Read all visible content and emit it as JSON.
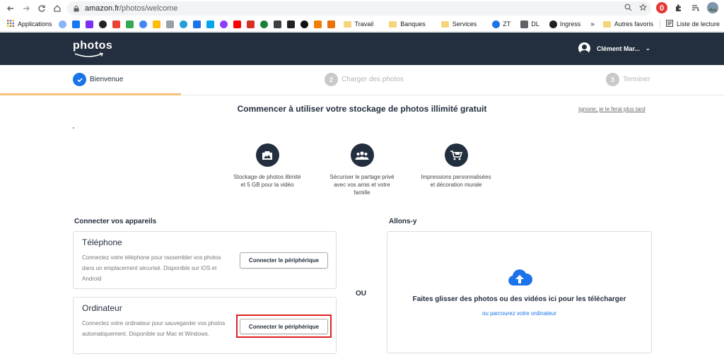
{
  "browser": {
    "url_host": "amazon.fr",
    "url_path": "/photos/welcome",
    "bookmarks": [
      {
        "label": "Applications",
        "icon": "apps-grid-icon",
        "color": "#e37400"
      },
      {
        "label": "",
        "icon": "network-icon",
        "color": "#8ab4f8"
      },
      {
        "label": "",
        "icon": "facebook-icon",
        "color": "#1877f2"
      },
      {
        "label": "",
        "icon": "bookmark-f-icon",
        "color": "#7b2ff7"
      },
      {
        "label": "",
        "icon": "bookmark-circle-icon",
        "color": "#222222"
      },
      {
        "label": "",
        "icon": "gmail-icon",
        "color": "#ea4335"
      },
      {
        "label": "",
        "icon": "drive-icon",
        "color": "#34a853"
      },
      {
        "label": "",
        "icon": "calendar-icon",
        "color": "#4285f4"
      },
      {
        "label": "",
        "icon": "keep-icon",
        "color": "#fbbc04"
      },
      {
        "label": "",
        "icon": "bookmark-s-icon",
        "color": "#9aa0a6"
      },
      {
        "label": "",
        "icon": "telegram-icon",
        "color": "#229ed9"
      },
      {
        "label": "",
        "icon": "chat-icon",
        "color": "#1a73e8"
      },
      {
        "label": "",
        "icon": "bookmark-teal-icon",
        "color": "#00a4ef"
      },
      {
        "label": "",
        "icon": "messenger-icon",
        "color": "#8a3ffc"
      },
      {
        "label": "",
        "icon": "youtube-icon",
        "color": "#ff0000"
      },
      {
        "label": "",
        "icon": "bookmark-red-icon",
        "color": "#d93025"
      },
      {
        "label": "",
        "icon": "bookmark-green-icon",
        "color": "#188038"
      },
      {
        "label": "",
        "icon": "bookmark-dark-icon",
        "color": "#3c4043"
      },
      {
        "label": "",
        "icon": "bookmark-u-icon",
        "color": "#202124"
      },
      {
        "label": "",
        "icon": "github-icon",
        "color": "#111111"
      },
      {
        "label": "",
        "icon": "bookmark-orange-icon",
        "color": "#f57c00"
      },
      {
        "label": "",
        "icon": "bookmark-chart-icon",
        "color": "#e8710a"
      }
    ],
    "folders": [
      "Travail",
      "Banques",
      "Services"
    ],
    "extra_bookmarks": [
      {
        "label": "ZT",
        "icon": "globe-icon"
      },
      {
        "label": "DL",
        "icon": "dl-icon"
      },
      {
        "label": "Ingress",
        "icon": "ingress-icon"
      }
    ],
    "overflow": "»",
    "other_favorites": "Autres favoris",
    "reading_list": "Liste de lecture"
  },
  "header": {
    "logo": "photos",
    "user_name": "Clément Mar...",
    "caret": "⌄"
  },
  "steps": [
    {
      "number": "✓",
      "label": "Bienvenue",
      "state": "active"
    },
    {
      "number": "2",
      "label": "Charger des photos",
      "state": "inactive"
    },
    {
      "number": "3",
      "label": "Terminer",
      "state": "inactive"
    }
  ],
  "main": {
    "title": "Commencer à utiliser votre stockage de photos illimité gratuit",
    "skip": "Ignorer, je le ferai plus tard"
  },
  "features": [
    {
      "icon": "photo-storage-icon",
      "line1": "Stockage de photos illimité",
      "line2": "et 5 GB pour la vidéo",
      "line3": ""
    },
    {
      "icon": "people-share-icon",
      "line1": "Sécuriser le partage privé",
      "line2": "avec vos amis et votre",
      "line3": "famille"
    },
    {
      "icon": "cart-print-icon",
      "line1": "Impressions personnalisées",
      "line2": "et décoration murale",
      "line3": ""
    }
  ],
  "connect": {
    "section_title": "Connecter vos appareils",
    "phone": {
      "title": "Téléphone",
      "desc": "Connectez votre téléphone pour rassembler vos photos dans un emplacement sécurisé. Disponible sur iOS et Android",
      "button": "Connecter le périphérique"
    },
    "computer": {
      "title": "Ordinateur",
      "desc": "Connectez votre ordinateur pour sauvegarder vos photos automatiquement. Disponible sur Mac et Windows.",
      "button": "Connecter le périphérique"
    },
    "or": "OU"
  },
  "upload": {
    "section_title": "Allons-y",
    "drop_text": "Faites glisser des photos ou des vidéos ici pour les télécharger",
    "browse_link": "ou parcourez votre ordinateur"
  },
  "colors": {
    "header_bg": "#232f3e",
    "accent_blue": "#1a73e8",
    "progress": "#f6c27a",
    "highlight_red": "#e02020"
  }
}
